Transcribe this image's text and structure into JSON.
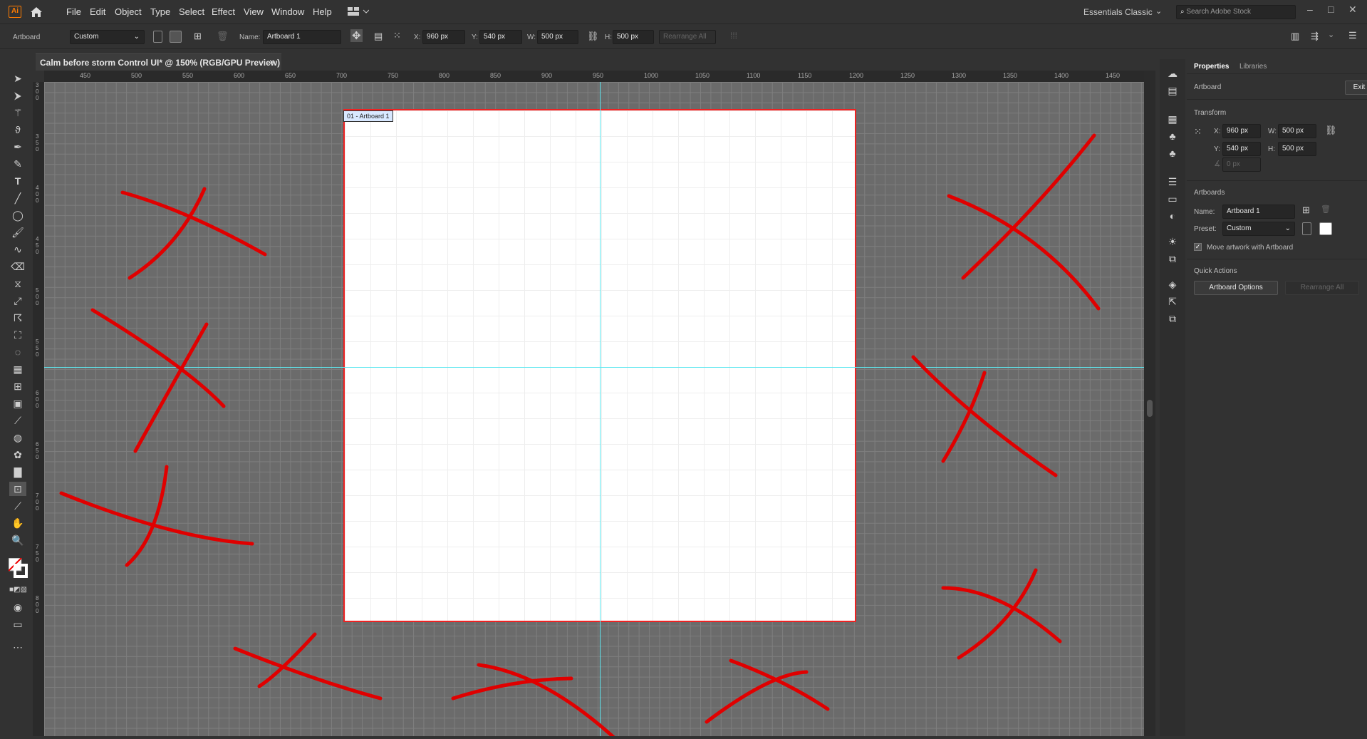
{
  "app": {
    "logo": "Ai",
    "menus": [
      "File",
      "Edit",
      "Object",
      "Type",
      "Select",
      "Effect",
      "View",
      "Window",
      "Help"
    ],
    "workspace": "Essentials Classic",
    "search_placeholder": "Search Adobe Stock"
  },
  "control": {
    "mode": "Artboard",
    "preset": "Custom",
    "name_label": "Name:",
    "name": "Artboard 1",
    "x_label": "X:",
    "x": "960 px",
    "y_label": "Y:",
    "y": "540 px",
    "w_label": "W:",
    "w": "500 px",
    "h_label": "H:",
    "h": "500 px",
    "rearrange": "Rearrange All"
  },
  "document": {
    "tab_title": "Calm before storm Control UI* @ 150% (RGB/GPU Preview)",
    "close": "×",
    "artboard_label": "01 - Artboard 1"
  },
  "ruler": {
    "h_ticks": [
      "450",
      "500",
      "550",
      "600",
      "650",
      "700",
      "750",
      "800",
      "850",
      "900",
      "950",
      "1000",
      "1050",
      "1100",
      "1150",
      "1200",
      "1250",
      "1300",
      "1350",
      "1400",
      "1450"
    ],
    "v_ticks": [
      "300",
      "350",
      "400",
      "450",
      "500",
      "550",
      "600",
      "650",
      "700",
      "750",
      "800"
    ]
  },
  "panel": {
    "tab_properties": "Properties",
    "tab_libraries": "Libraries",
    "context": "Artboard",
    "exit": "Exit",
    "transform": "Transform",
    "x_label": "X:",
    "x": "960 px",
    "y_label": "Y:",
    "y": "540 px",
    "w_label": "W:",
    "w": "500 px",
    "h_label": "H:",
    "h": "500 px",
    "angle": "0 px",
    "artboards": "Artboards",
    "name_label": "Name:",
    "name": "Artboard 1",
    "preset_label": "Preset:",
    "preset": "Custom",
    "move_artwork": "Move artwork with Artboard",
    "quick_actions": "Quick Actions",
    "artboard_options": "Artboard Options",
    "rearrange_all": "Rearrange All"
  },
  "colors": {
    "annotation": "#e00000",
    "guide": "#5ee8f0",
    "artboard_border": "#e22222"
  },
  "tools": [
    "selection-tool",
    "direct-selection-tool",
    "magic-wand-tool",
    "lasso-tool",
    "pen-tool",
    "curvature-tool",
    "type-tool",
    "line-tool",
    "ellipse-tool",
    "paintbrush-tool",
    "shaper-tool",
    "eraser-tool",
    "rotate-tool",
    "scale-tool",
    "warp-tool",
    "free-transform-tool",
    "shape-builder-tool",
    "perspective-grid-tool",
    "mesh-tool",
    "gradient-tool",
    "eyedropper-tool",
    "blend-tool",
    "symbol-sprayer-tool",
    "column-graph-tool",
    "artboard-tool",
    "slice-tool",
    "hand-tool",
    "zoom-tool"
  ]
}
